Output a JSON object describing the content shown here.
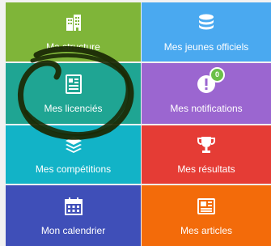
{
  "colors": {
    "structure": "#7fb539",
    "jeunes": "#4aa9f0",
    "licencies": "#1fa593",
    "notifications": "#9b66d0",
    "competitions": "#12b3c7",
    "resultats": "#e53c35",
    "calendrier": "#3f4fb8",
    "articles": "#f36b0a",
    "scribble": "#1b2a05"
  },
  "tiles": [
    {
      "label": "Ma structure",
      "icon": "building-icon"
    },
    {
      "label": "Mes jeunes officiels",
      "icon": "database-icon"
    },
    {
      "label": "Mes licenciés",
      "icon": "id-card-icon"
    },
    {
      "label": "Mes notifications",
      "icon": "bell-icon",
      "badge": "0"
    },
    {
      "label": "Mes compétitions",
      "icon": "layers-icon"
    },
    {
      "label": "Mes résultats",
      "icon": "trophy-icon"
    },
    {
      "label": "Mon calendrier",
      "icon": "calendar-icon"
    },
    {
      "label": "Mes articles",
      "icon": "newspaper-icon"
    }
  ]
}
